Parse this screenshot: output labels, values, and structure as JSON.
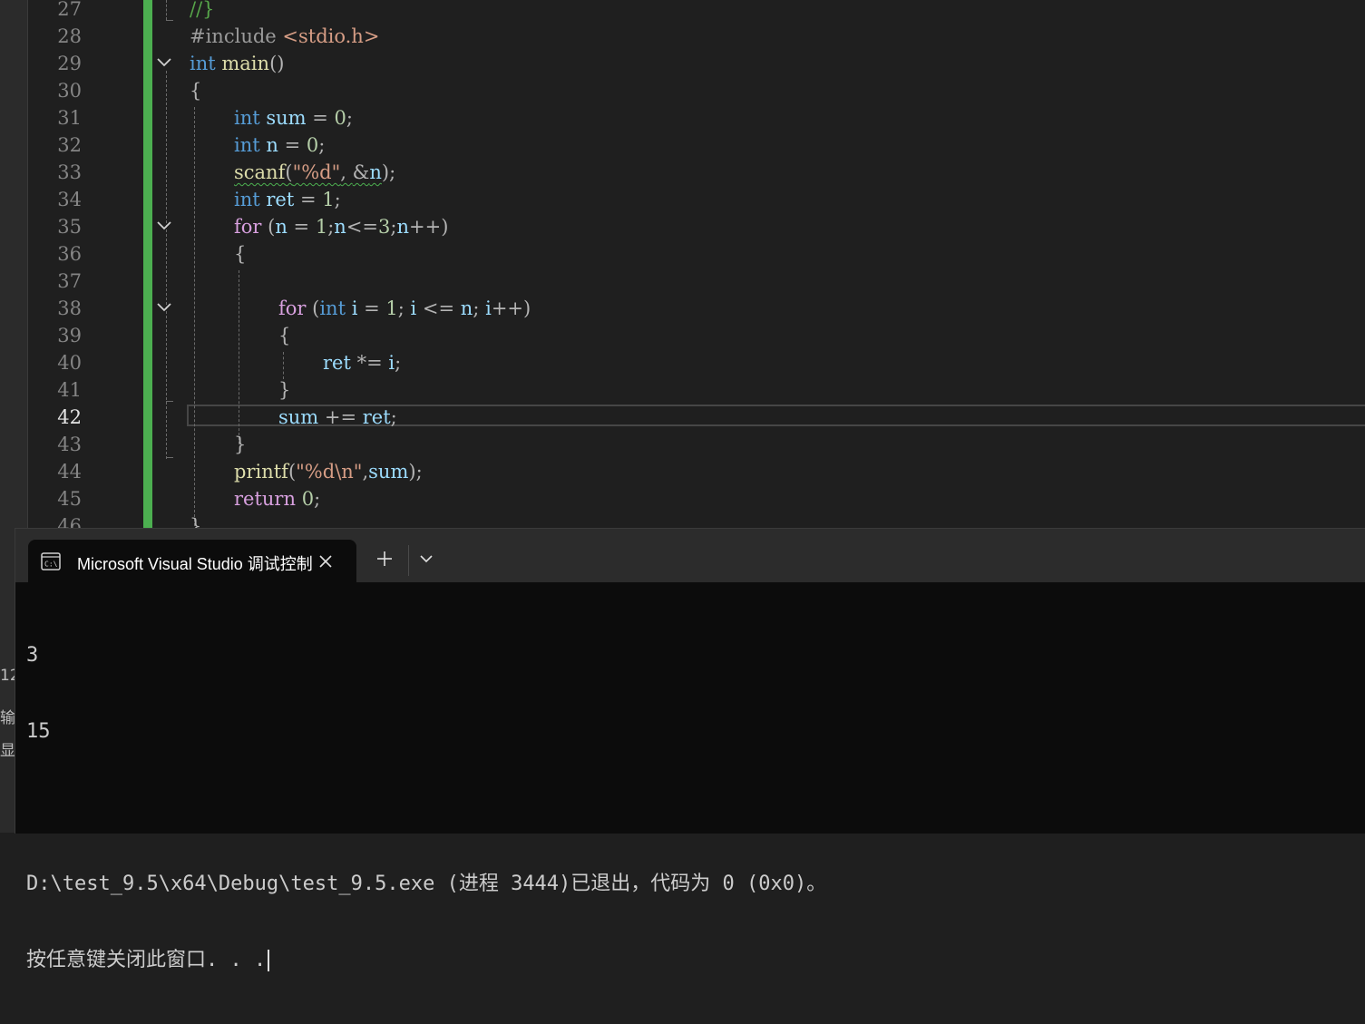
{
  "editor": {
    "lines": [
      {
        "num": "27",
        "indent": 0,
        "fold": false,
        "tokens": [
          {
            "t": "//}",
            "c": "cmt"
          }
        ]
      },
      {
        "num": "28",
        "indent": 0,
        "fold": false,
        "tokens": [
          {
            "t": "#include ",
            "c": "pp"
          },
          {
            "t": "<stdio.h>",
            "c": "inc"
          }
        ]
      },
      {
        "num": "29",
        "indent": 0,
        "fold": true,
        "tokens": [
          {
            "t": "int",
            "c": "kw"
          },
          {
            "t": " ",
            "c": ""
          },
          {
            "t": "main",
            "c": "fn"
          },
          {
            "t": "()",
            "c": "pun"
          }
        ]
      },
      {
        "num": "30",
        "indent": 0,
        "fold": false,
        "tokens": [
          {
            "t": "{",
            "c": "pun"
          }
        ]
      },
      {
        "num": "31",
        "indent": 1,
        "fold": false,
        "tokens": [
          {
            "t": "int",
            "c": "kw"
          },
          {
            "t": " ",
            "c": ""
          },
          {
            "t": "sum",
            "c": "var"
          },
          {
            "t": " = ",
            "c": "op"
          },
          {
            "t": "0",
            "c": "num"
          },
          {
            "t": ";",
            "c": "pun"
          }
        ]
      },
      {
        "num": "32",
        "indent": 1,
        "fold": false,
        "tokens": [
          {
            "t": "int",
            "c": "kw"
          },
          {
            "t": " ",
            "c": ""
          },
          {
            "t": "n",
            "c": "var"
          },
          {
            "t": " = ",
            "c": "op"
          },
          {
            "t": "0",
            "c": "num"
          },
          {
            "t": ";",
            "c": "pun"
          }
        ]
      },
      {
        "num": "33",
        "indent": 1,
        "fold": false,
        "tokens": [
          {
            "t": "scanf",
            "c": "fn squig"
          },
          {
            "t": "(",
            "c": "pun squig"
          },
          {
            "t": "\"%d\"",
            "c": "str squig"
          },
          {
            "t": ", ",
            "c": "pun squig"
          },
          {
            "t": "&",
            "c": "op squig"
          },
          {
            "t": "n",
            "c": "var squig"
          },
          {
            "t": ");",
            "c": "pun"
          }
        ]
      },
      {
        "num": "34",
        "indent": 1,
        "fold": false,
        "tokens": [
          {
            "t": "int",
            "c": "kw"
          },
          {
            "t": " ",
            "c": ""
          },
          {
            "t": "ret",
            "c": "var"
          },
          {
            "t": " = ",
            "c": "op"
          },
          {
            "t": "1",
            "c": "num"
          },
          {
            "t": ";",
            "c": "pun"
          }
        ]
      },
      {
        "num": "35",
        "indent": 1,
        "fold": true,
        "tokens": [
          {
            "t": "for",
            "c": "ctl"
          },
          {
            "t": " (",
            "c": "pun"
          },
          {
            "t": "n",
            "c": "var"
          },
          {
            "t": " = ",
            "c": "op"
          },
          {
            "t": "1",
            "c": "num"
          },
          {
            "t": ";",
            "c": "pun"
          },
          {
            "t": "n",
            "c": "var"
          },
          {
            "t": "<=",
            "c": "op"
          },
          {
            "t": "3",
            "c": "num"
          },
          {
            "t": ";",
            "c": "pun"
          },
          {
            "t": "n",
            "c": "var"
          },
          {
            "t": "++)",
            "c": "op"
          }
        ]
      },
      {
        "num": "36",
        "indent": 1,
        "fold": false,
        "tokens": [
          {
            "t": "{",
            "c": "pun"
          }
        ]
      },
      {
        "num": "37",
        "indent": 2,
        "fold": false,
        "tokens": []
      },
      {
        "num": "38",
        "indent": 2,
        "fold": true,
        "tokens": [
          {
            "t": "for",
            "c": "ctl"
          },
          {
            "t": " (",
            "c": "pun"
          },
          {
            "t": "int",
            "c": "kw"
          },
          {
            "t": " ",
            "c": ""
          },
          {
            "t": "i",
            "c": "var"
          },
          {
            "t": " = ",
            "c": "op"
          },
          {
            "t": "1",
            "c": "num"
          },
          {
            "t": "; ",
            "c": "pun"
          },
          {
            "t": "i",
            "c": "var"
          },
          {
            "t": " <= ",
            "c": "op"
          },
          {
            "t": "n",
            "c": "var"
          },
          {
            "t": "; ",
            "c": "pun"
          },
          {
            "t": "i",
            "c": "var"
          },
          {
            "t": "++)",
            "c": "op"
          }
        ]
      },
      {
        "num": "39",
        "indent": 2,
        "fold": false,
        "tokens": [
          {
            "t": "{",
            "c": "pun"
          }
        ]
      },
      {
        "num": "40",
        "indent": 3,
        "fold": false,
        "tokens": [
          {
            "t": "ret",
            "c": "var"
          },
          {
            "t": " *= ",
            "c": "op"
          },
          {
            "t": "i",
            "c": "var"
          },
          {
            "t": ";",
            "c": "pun"
          }
        ]
      },
      {
        "num": "41",
        "indent": 2,
        "fold": false,
        "tokens": [
          {
            "t": "}",
            "c": "pun"
          }
        ]
      },
      {
        "num": "42",
        "indent": 2,
        "fold": false,
        "tokens": [
          {
            "t": "sum",
            "c": "var"
          },
          {
            "t": " += ",
            "c": "op"
          },
          {
            "t": "ret",
            "c": "var"
          },
          {
            "t": ";",
            "c": "pun"
          }
        ],
        "active": true
      },
      {
        "num": "43",
        "indent": 1,
        "fold": false,
        "tokens": [
          {
            "t": "}",
            "c": "pun"
          }
        ]
      },
      {
        "num": "44",
        "indent": 1,
        "fold": false,
        "tokens": [
          {
            "t": "printf",
            "c": "fn"
          },
          {
            "t": "(",
            "c": "pun"
          },
          {
            "t": "\"%d\\n\"",
            "c": "str"
          },
          {
            "t": ",",
            "c": "pun"
          },
          {
            "t": "sum",
            "c": "var"
          },
          {
            "t": ");",
            "c": "pun"
          }
        ]
      },
      {
        "num": "45",
        "indent": 1,
        "fold": false,
        "tokens": [
          {
            "t": "return",
            "c": "ctl"
          },
          {
            "t": " ",
            "c": ""
          },
          {
            "t": "0",
            "c": "num"
          },
          {
            "t": ";",
            "c": "pun"
          }
        ]
      },
      {
        "num": "46",
        "indent": 0,
        "fold": false,
        "tokens": [
          {
            "t": "}",
            "c": "pun"
          }
        ]
      }
    ]
  },
  "terminal": {
    "tab_title": "Microsoft Visual Studio 调试控制台",
    "output_lines": [
      "3",
      "15",
      "",
      "D:\\test_9.5\\x64\\Debug\\test_9.5.exe (进程 3444)已退出，代码为 0 (0x0)。",
      "按任意键关闭此窗口. . ."
    ]
  },
  "background_panel": {
    "fragments": [
      "12",
      "输",
      "显"
    ]
  },
  "colors": {
    "change_bar": "#4caf50",
    "keyword": "#569cd6",
    "control": "#d8a0df",
    "variable": "#9cdcfe",
    "function": "#dcdcaa",
    "string": "#d69d85",
    "number": "#b5cea8",
    "terminal_bg": "#0c0c0c"
  }
}
